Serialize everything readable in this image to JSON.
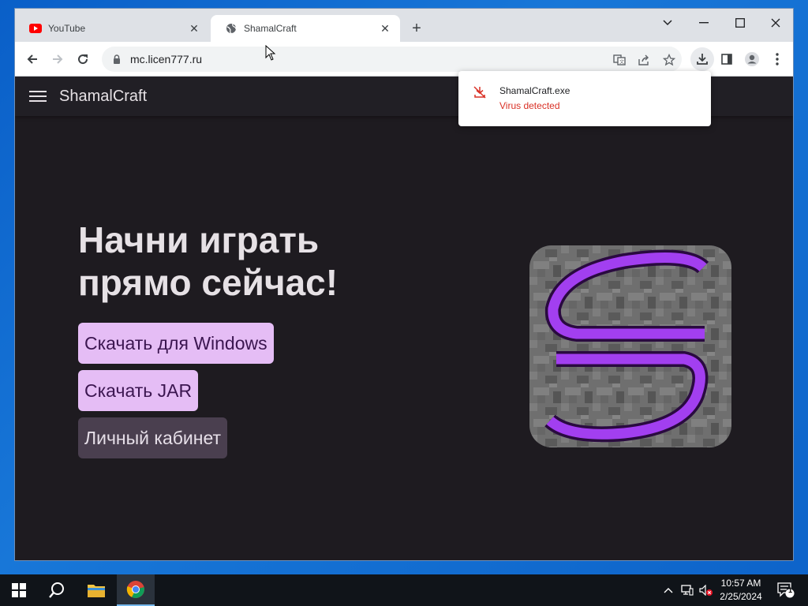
{
  "browser": {
    "tabs": [
      {
        "title": "YouTube",
        "icon": "youtube-icon",
        "active": false
      },
      {
        "title": "ShamalCraft",
        "icon": "globe-icon",
        "active": true
      }
    ],
    "url": "mc.licen777.ru"
  },
  "download": {
    "file_name": "ShamalCraft.exe",
    "status": "Virus detected",
    "status_color": "#d93025"
  },
  "site": {
    "brand": "ShamalCraft",
    "headline_line1": "Начни играть",
    "headline_line2": "прямо сейчас!",
    "buttons": {
      "download_windows": "Скачать для Windows",
      "download_jar": "Скачать JAR",
      "account": "Личный кабинет"
    },
    "accent_color": "#e5bdf5",
    "logo_letter_color": "#a23ff0"
  },
  "taskbar": {
    "time": "10:57 AM",
    "date": "2/25/2024",
    "notification_count": "1"
  }
}
